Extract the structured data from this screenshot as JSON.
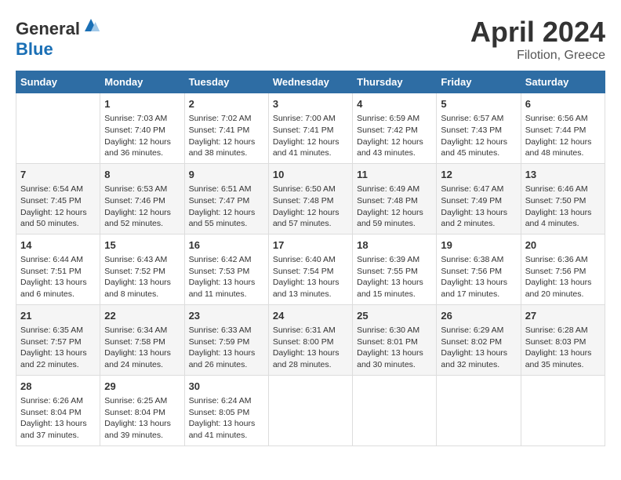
{
  "header": {
    "logo_general": "General",
    "logo_blue": "Blue",
    "month": "April 2024",
    "location": "Filotion, Greece"
  },
  "weekdays": [
    "Sunday",
    "Monday",
    "Tuesday",
    "Wednesday",
    "Thursday",
    "Friday",
    "Saturday"
  ],
  "weeks": [
    [
      {
        "day": "",
        "info": ""
      },
      {
        "day": "1",
        "info": "Sunrise: 7:03 AM\nSunset: 7:40 PM\nDaylight: 12 hours\nand 36 minutes."
      },
      {
        "day": "2",
        "info": "Sunrise: 7:02 AM\nSunset: 7:41 PM\nDaylight: 12 hours\nand 38 minutes."
      },
      {
        "day": "3",
        "info": "Sunrise: 7:00 AM\nSunset: 7:41 PM\nDaylight: 12 hours\nand 41 minutes."
      },
      {
        "day": "4",
        "info": "Sunrise: 6:59 AM\nSunset: 7:42 PM\nDaylight: 12 hours\nand 43 minutes."
      },
      {
        "day": "5",
        "info": "Sunrise: 6:57 AM\nSunset: 7:43 PM\nDaylight: 12 hours\nand 45 minutes."
      },
      {
        "day": "6",
        "info": "Sunrise: 6:56 AM\nSunset: 7:44 PM\nDaylight: 12 hours\nand 48 minutes."
      }
    ],
    [
      {
        "day": "7",
        "info": "Sunrise: 6:54 AM\nSunset: 7:45 PM\nDaylight: 12 hours\nand 50 minutes."
      },
      {
        "day": "8",
        "info": "Sunrise: 6:53 AM\nSunset: 7:46 PM\nDaylight: 12 hours\nand 52 minutes."
      },
      {
        "day": "9",
        "info": "Sunrise: 6:51 AM\nSunset: 7:47 PM\nDaylight: 12 hours\nand 55 minutes."
      },
      {
        "day": "10",
        "info": "Sunrise: 6:50 AM\nSunset: 7:48 PM\nDaylight: 12 hours\nand 57 minutes."
      },
      {
        "day": "11",
        "info": "Sunrise: 6:49 AM\nSunset: 7:48 PM\nDaylight: 12 hours\nand 59 minutes."
      },
      {
        "day": "12",
        "info": "Sunrise: 6:47 AM\nSunset: 7:49 PM\nDaylight: 13 hours\nand 2 minutes."
      },
      {
        "day": "13",
        "info": "Sunrise: 6:46 AM\nSunset: 7:50 PM\nDaylight: 13 hours\nand 4 minutes."
      }
    ],
    [
      {
        "day": "14",
        "info": "Sunrise: 6:44 AM\nSunset: 7:51 PM\nDaylight: 13 hours\nand 6 minutes."
      },
      {
        "day": "15",
        "info": "Sunrise: 6:43 AM\nSunset: 7:52 PM\nDaylight: 13 hours\nand 8 minutes."
      },
      {
        "day": "16",
        "info": "Sunrise: 6:42 AM\nSunset: 7:53 PM\nDaylight: 13 hours\nand 11 minutes."
      },
      {
        "day": "17",
        "info": "Sunrise: 6:40 AM\nSunset: 7:54 PM\nDaylight: 13 hours\nand 13 minutes."
      },
      {
        "day": "18",
        "info": "Sunrise: 6:39 AM\nSunset: 7:55 PM\nDaylight: 13 hours\nand 15 minutes."
      },
      {
        "day": "19",
        "info": "Sunrise: 6:38 AM\nSunset: 7:56 PM\nDaylight: 13 hours\nand 17 minutes."
      },
      {
        "day": "20",
        "info": "Sunrise: 6:36 AM\nSunset: 7:56 PM\nDaylight: 13 hours\nand 20 minutes."
      }
    ],
    [
      {
        "day": "21",
        "info": "Sunrise: 6:35 AM\nSunset: 7:57 PM\nDaylight: 13 hours\nand 22 minutes."
      },
      {
        "day": "22",
        "info": "Sunrise: 6:34 AM\nSunset: 7:58 PM\nDaylight: 13 hours\nand 24 minutes."
      },
      {
        "day": "23",
        "info": "Sunrise: 6:33 AM\nSunset: 7:59 PM\nDaylight: 13 hours\nand 26 minutes."
      },
      {
        "day": "24",
        "info": "Sunrise: 6:31 AM\nSunset: 8:00 PM\nDaylight: 13 hours\nand 28 minutes."
      },
      {
        "day": "25",
        "info": "Sunrise: 6:30 AM\nSunset: 8:01 PM\nDaylight: 13 hours\nand 30 minutes."
      },
      {
        "day": "26",
        "info": "Sunrise: 6:29 AM\nSunset: 8:02 PM\nDaylight: 13 hours\nand 32 minutes."
      },
      {
        "day": "27",
        "info": "Sunrise: 6:28 AM\nSunset: 8:03 PM\nDaylight: 13 hours\nand 35 minutes."
      }
    ],
    [
      {
        "day": "28",
        "info": "Sunrise: 6:26 AM\nSunset: 8:04 PM\nDaylight: 13 hours\nand 37 minutes."
      },
      {
        "day": "29",
        "info": "Sunrise: 6:25 AM\nSunset: 8:04 PM\nDaylight: 13 hours\nand 39 minutes."
      },
      {
        "day": "30",
        "info": "Sunrise: 6:24 AM\nSunset: 8:05 PM\nDaylight: 13 hours\nand 41 minutes."
      },
      {
        "day": "",
        "info": ""
      },
      {
        "day": "",
        "info": ""
      },
      {
        "day": "",
        "info": ""
      },
      {
        "day": "",
        "info": ""
      }
    ]
  ]
}
